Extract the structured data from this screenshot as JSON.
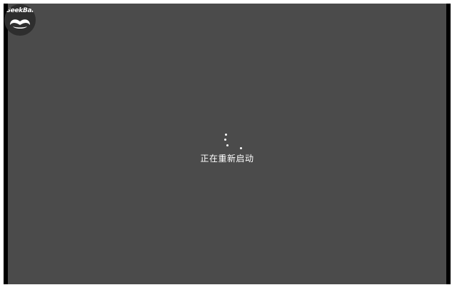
{
  "brand": {
    "name": "GeekBar",
    "icon": "mustache-logo-icon"
  },
  "screen": {
    "status_text": "正在重新启动",
    "spinner_icon": "loading-spinner-icon",
    "background_color": "#4b4b4b",
    "text_color": "#ffffff"
  }
}
